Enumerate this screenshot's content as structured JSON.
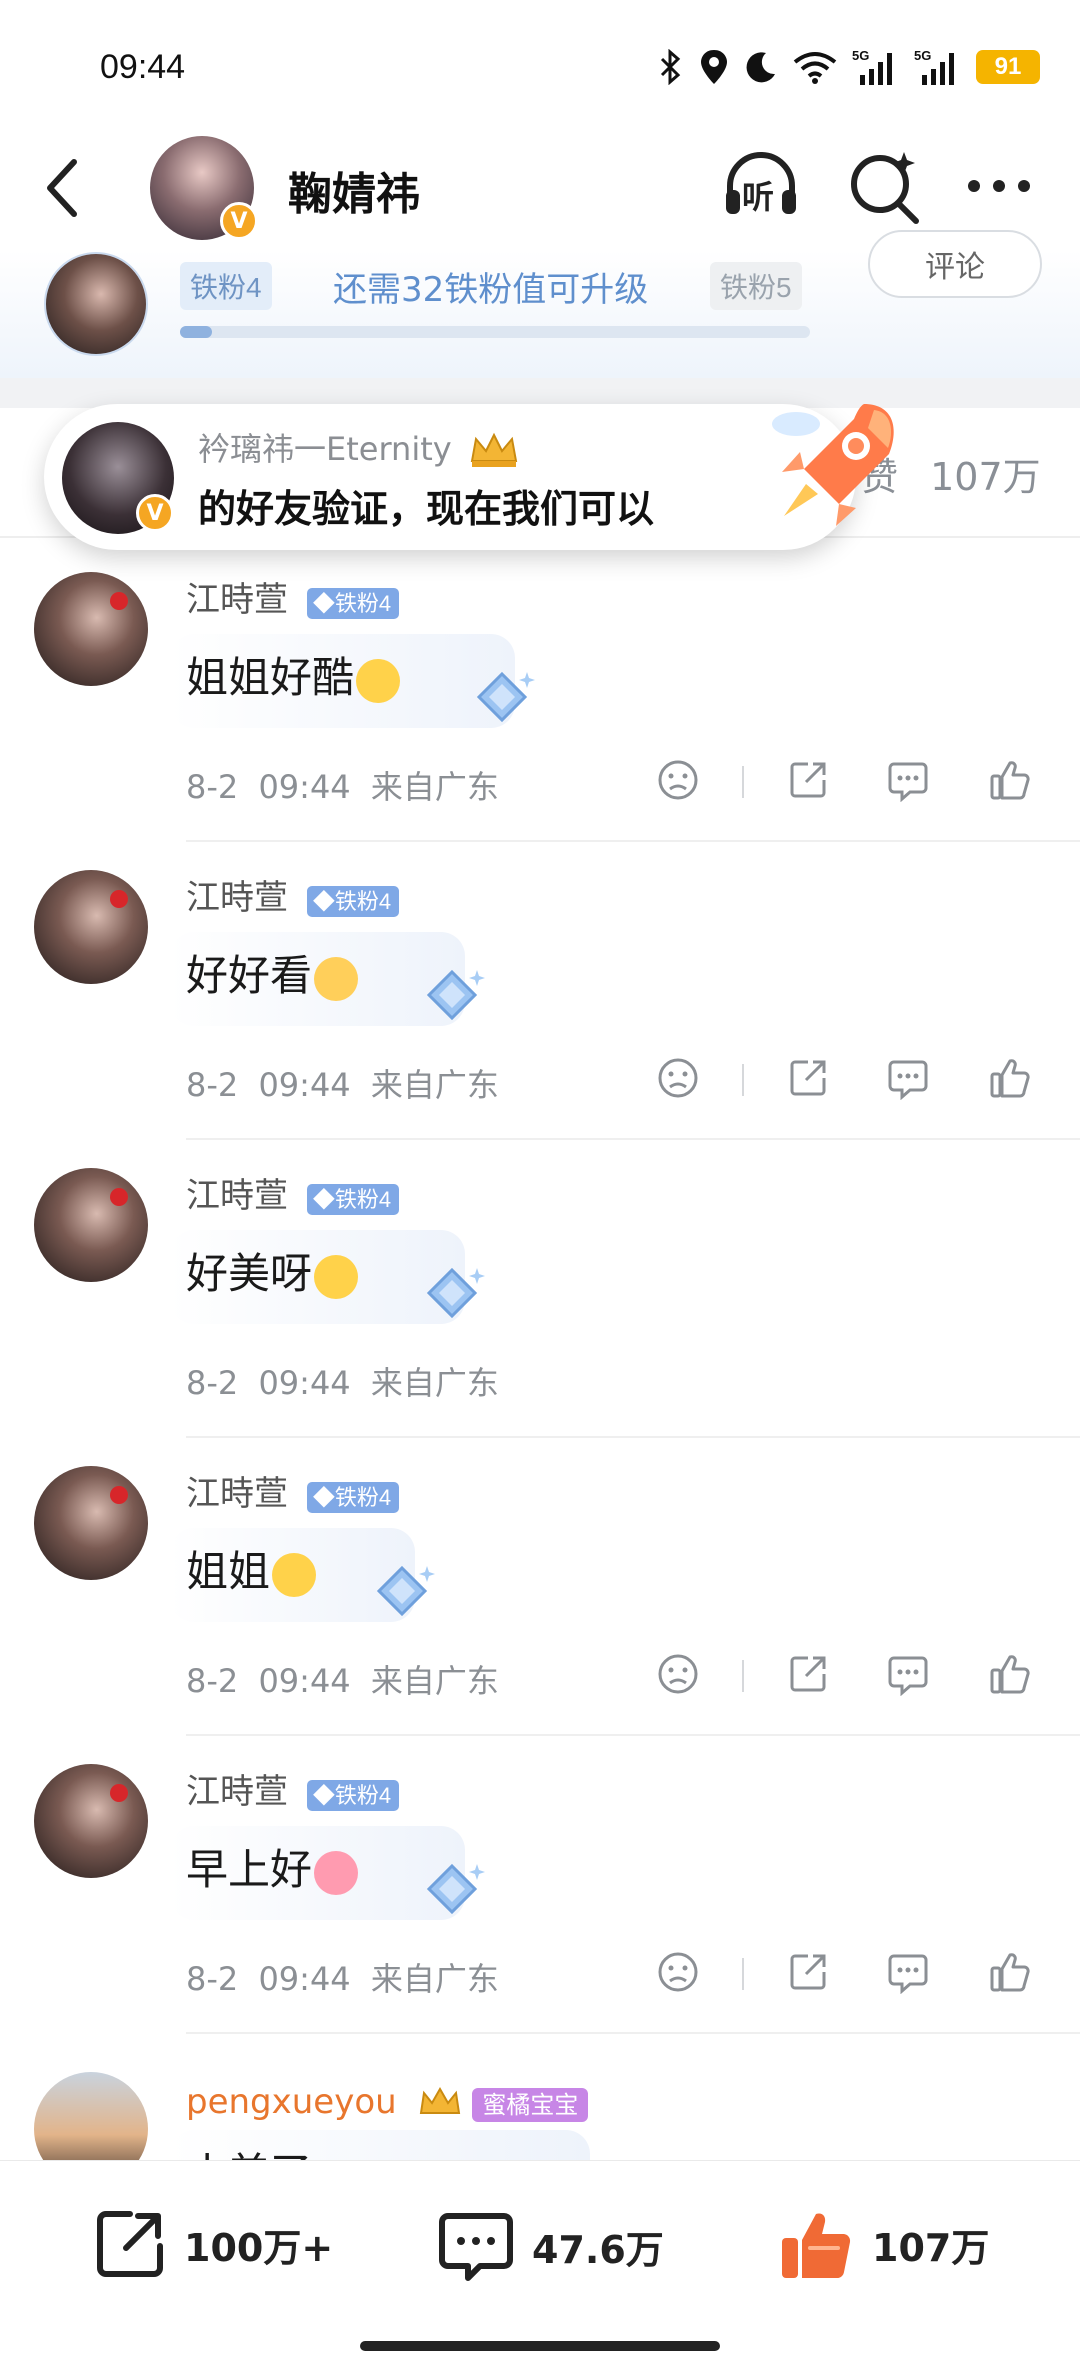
{
  "status": {
    "time": "09:44",
    "battery": "91",
    "net1": "5G",
    "net2": "5G"
  },
  "header": {
    "title": "鞠婧祎",
    "listen_label": "听",
    "verified": "V"
  },
  "fan": {
    "current_level": "铁粉4",
    "next_level": "铁粉5",
    "upgrade_text": "还需32铁粉值可升级",
    "progress": 0.05,
    "comment_button": "评论"
  },
  "stats": {
    "likes_label": "赞",
    "likes_value": "107万"
  },
  "toast": {
    "name": "衿璃祎一Eternity",
    "message": "的好友验证，现在我们可以"
  },
  "comments": [
    {
      "user": "江時萱",
      "badge": "铁粉4",
      "text": "姐姐好酷",
      "date": "8-2",
      "time": "09:44",
      "location": "来自广东"
    },
    {
      "user": "江時萱",
      "badge": "铁粉4",
      "text": "好好看",
      "date": "8-2",
      "time": "09:44",
      "location": "来自广东"
    },
    {
      "user": "江時萱",
      "badge": "铁粉4",
      "text": "好美呀",
      "date": "8-2",
      "time": "09:44",
      "location": "来自广东"
    },
    {
      "user": "江時萱",
      "badge": "铁粉4",
      "text": "姐姐",
      "date": "8-2",
      "time": "09:44",
      "location": "来自广东"
    },
    {
      "user": "江時萱",
      "badge": "铁粉4",
      "text": "早上好",
      "date": "8-2",
      "time": "09:44",
      "location": "来自广东"
    }
  ],
  "last_comment": {
    "user": "pengxueyou",
    "tag": "蜜橘宝宝",
    "text": "小美了"
  },
  "bottom": {
    "share": "100万+",
    "comments": "47.6万",
    "likes": "107万"
  },
  "colors": {
    "accent_blue": "#5f8fcd",
    "like_orange": "#f06a35",
    "battery": "#f5b400"
  }
}
